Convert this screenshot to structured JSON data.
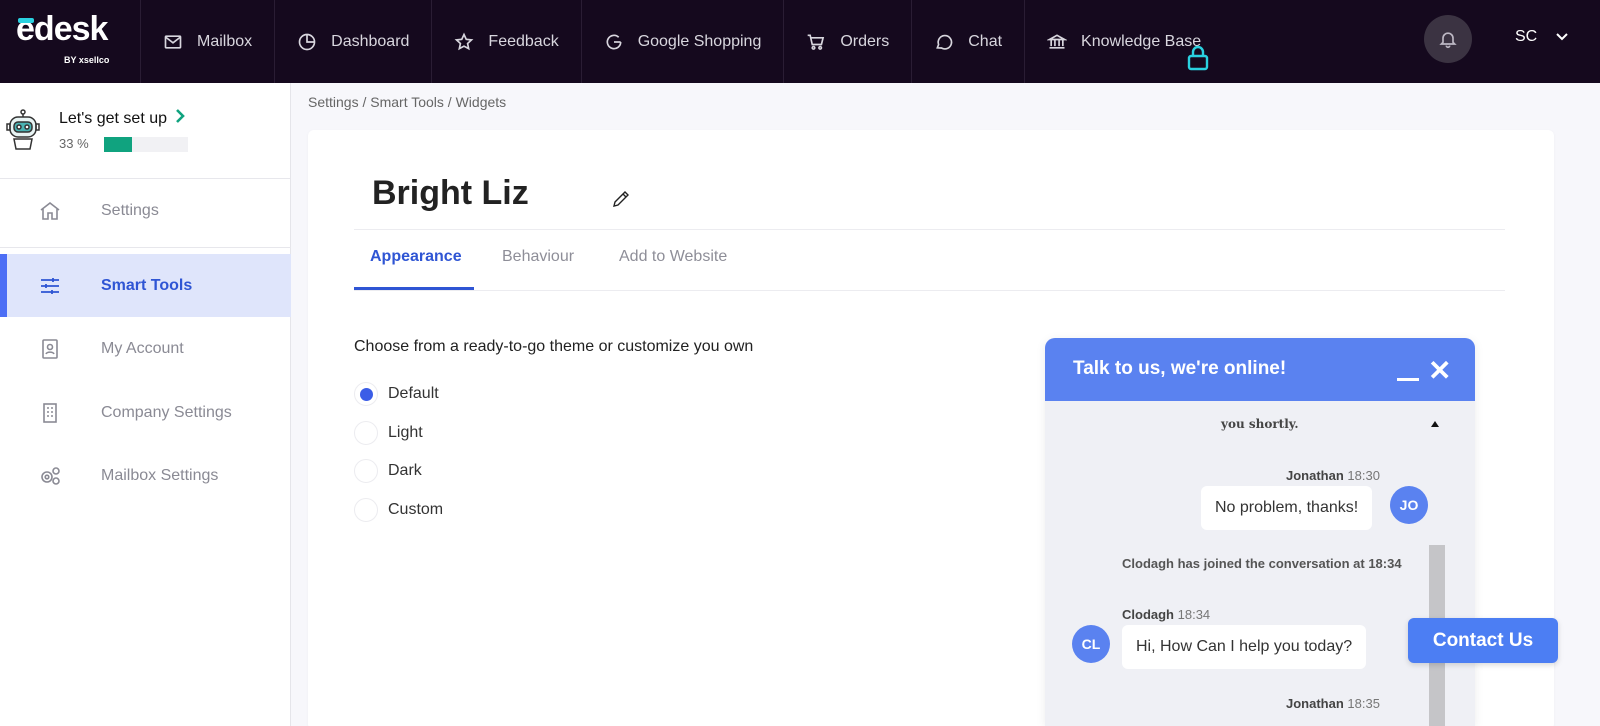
{
  "brand": {
    "name_e": "e",
    "name_rest": "desk",
    "sub": "BY xsellco",
    "accent": "#2ad1e0"
  },
  "nav": {
    "items": [
      {
        "label": "Mailbox",
        "icon": "mail-icon"
      },
      {
        "label": "Dashboard",
        "icon": "pie-chart-icon"
      },
      {
        "label": "Feedback",
        "icon": "star-icon"
      },
      {
        "label": "Google Shopping",
        "icon": "google-icon"
      },
      {
        "label": "Orders",
        "icon": "cart-icon"
      },
      {
        "label": "Chat",
        "icon": "chat-bubble-icon"
      },
      {
        "label": "Knowledge Base",
        "icon": "bank-icon"
      }
    ],
    "user_initials": "SC"
  },
  "setup": {
    "title": "Let's get set up",
    "percent_label": "33 %",
    "progress": 0.33,
    "progress_color": "#10a37f"
  },
  "sidebar": {
    "items": [
      {
        "label": "Settings",
        "icon": "home-icon"
      },
      {
        "label": "Smart Tools",
        "icon": "sliders-icon"
      },
      {
        "label": "My Account",
        "icon": "badge-icon"
      },
      {
        "label": "Company Settings",
        "icon": "building-icon"
      },
      {
        "label": "Mailbox Settings",
        "icon": "gears-icon"
      }
    ],
    "active_index": 1
  },
  "breadcrumb": "Settings / Smart Tools / Widgets",
  "widget_name": "Bright Liz",
  "tabs": [
    {
      "label": "Appearance",
      "active": true
    },
    {
      "label": "Behaviour",
      "active": false
    },
    {
      "label": "Add to Website",
      "active": false
    }
  ],
  "theme": {
    "prompt": "Choose from a ready-to-go theme or customize you own",
    "options": [
      "Default",
      "Light",
      "Dark",
      "Custom"
    ],
    "selected": "Default"
  },
  "chat": {
    "header": "Talk to us, we're online!",
    "close_symbol": "✕",
    "faded_text": "you shortly.",
    "messages": [
      {
        "author": "Jonathan",
        "time": "18:30",
        "text": "No problem, thanks!",
        "initials": "JO"
      },
      {
        "author": "Clodagh",
        "time": "18:34",
        "text": "Hi, How Can I help you today?",
        "initials": "CL"
      },
      {
        "author": "Jonathan",
        "time": "18:35"
      }
    ],
    "system": "Clodagh has joined the conversation at 18:34",
    "accent": "#5a82f0"
  },
  "contact_button": "Contact Us"
}
